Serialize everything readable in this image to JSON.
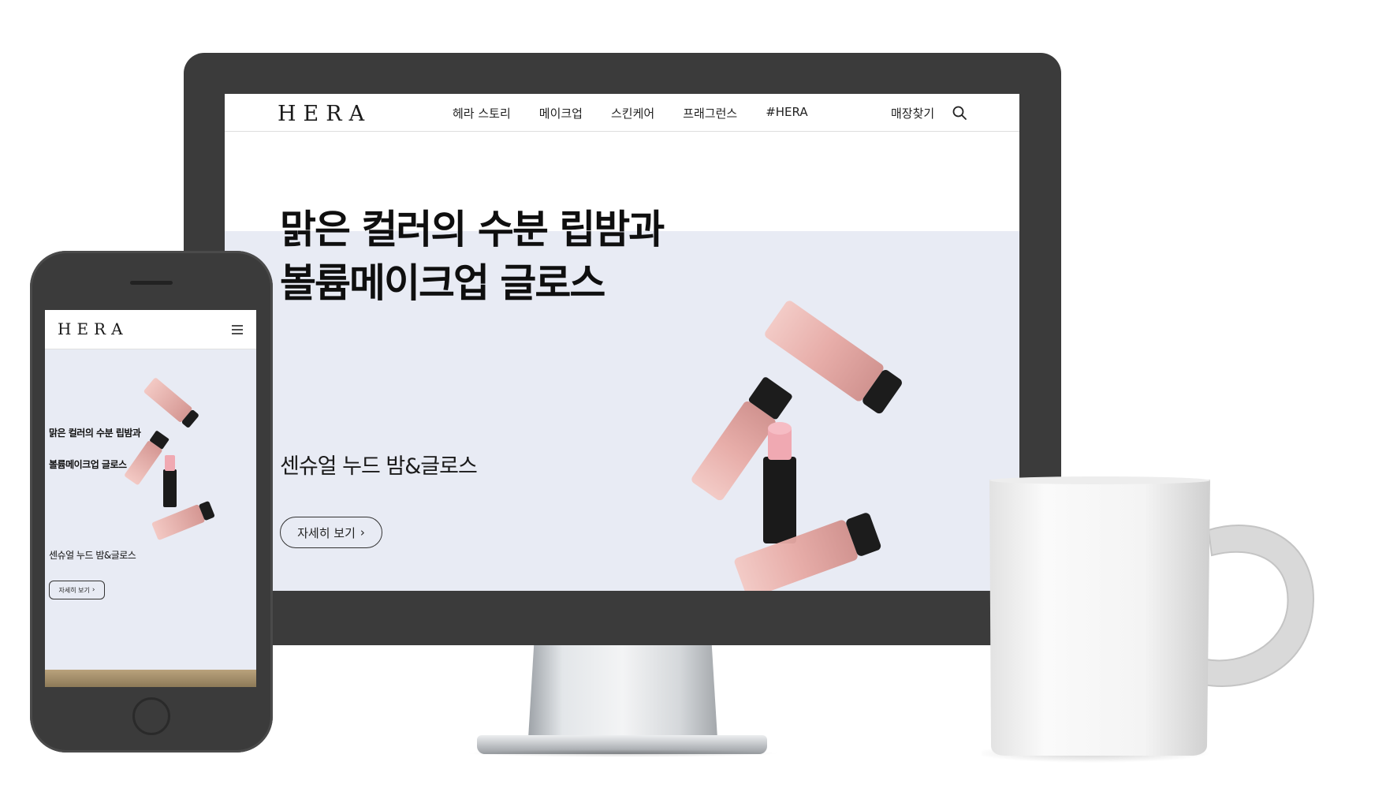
{
  "desktop": {
    "header": {
      "logo": "HERA",
      "nav": [
        "헤라 스토리",
        "메이크업",
        "스킨케어",
        "프래그런스",
        "#HERA"
      ],
      "store_label": "매장찾기"
    },
    "hero": {
      "title": "맑은 컬러의 수분 립밤과\n볼륨메이크업 글로스",
      "subtitle": "센슈얼 누드 밤&글로스",
      "button_label": "자세히 보기",
      "background": "#e8ebf4"
    }
  },
  "mobile": {
    "header": {
      "logo": "HERA"
    },
    "hero": {
      "title_line1": "맑은 컬러의 수분 립밤과",
      "title_line2": "볼륨메이크업 글로스",
      "subtitle": "센슈얼 누드 밤&글로스",
      "button_label": "자세히 보기"
    }
  },
  "colors": {
    "device_frame": "#3b3b3b",
    "hero_background": "#e8ebf4",
    "product_pink": "#e8b4b0",
    "product_black": "#1a1a1a"
  },
  "icons": [
    "search-icon",
    "chevron-right-icon",
    "hamburger-menu-icon"
  ]
}
